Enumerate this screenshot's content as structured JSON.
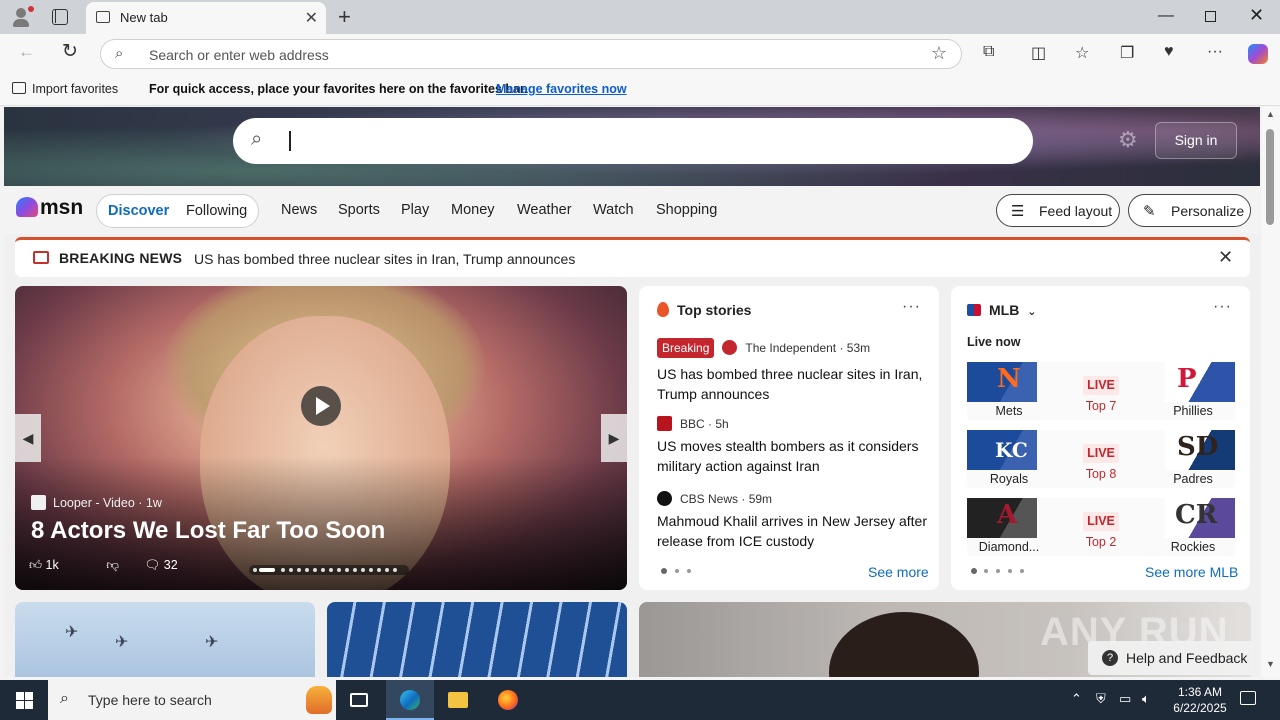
{
  "browser": {
    "tab_title": "New tab",
    "address_placeholder": "Search or enter web address",
    "favbar": {
      "import_label": "Import favorites",
      "message": "For quick access, place your favorites here on the favorites bar.",
      "manage_link": "Manage favorites now"
    }
  },
  "msn": {
    "signin_label": "Sign in",
    "logo_text": "msn",
    "tabs": {
      "discover": "Discover",
      "following": "Following"
    },
    "nav": [
      "News",
      "Sports",
      "Play",
      "Money",
      "Weather",
      "Watch",
      "Shopping"
    ],
    "feed_layout_label": "Feed layout",
    "personalize_label": "Personalize",
    "breaking": {
      "label": "BREAKING NEWS",
      "headline": "US has bombed three nuclear sites in Iran, Trump announces"
    },
    "hero": {
      "source": "Looper - Video",
      "age": "1w",
      "title": "8 Actors We Lost Far Too Soon",
      "likes": "1k",
      "comments": "32"
    },
    "top_stories": {
      "title": "Top stories",
      "see_more": "See more",
      "items": [
        {
          "badge": "Breaking",
          "source": "The Independent",
          "age": "53m",
          "title": "US has bombed three nuclear sites in Iran, Trump announces"
        },
        {
          "source": "BBC",
          "age": "5h",
          "title": "US moves stealth bombers as it considers military action against Iran"
        },
        {
          "source": "CBS News",
          "age": "59m",
          "title": "Mahmoud Khalil arrives in New Jersey after release from ICE custody"
        }
      ]
    },
    "mlb": {
      "title": "MLB",
      "live_now": "Live now",
      "see_more": "See more MLB",
      "live_label": "LIVE",
      "games": [
        {
          "home": "Mets",
          "away": "Phillies",
          "inning": "Top 7"
        },
        {
          "home": "Royals",
          "away": "Padres",
          "inning": "Top 8"
        },
        {
          "home": "Diamond...",
          "away": "Rockies",
          "inning": "Top 2"
        }
      ]
    },
    "help_label": "Help and Feedback",
    "watermark": "ANY RUN"
  },
  "taskbar": {
    "search_placeholder": "Type here to search",
    "time": "1:36 AM",
    "date": "6/22/2025"
  },
  "colors": {
    "accent": "#0f6cbd",
    "breaking_red": "#c4262e",
    "taskbar": "#1f2a38"
  }
}
